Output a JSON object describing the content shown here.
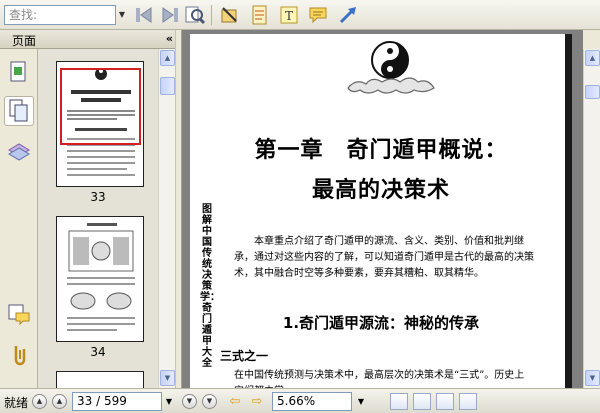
{
  "toolbar": {
    "search_placeholder": "查找:",
    "icons": [
      "prev-find-icon",
      "next-find-icon",
      "find-zoom-icon",
      "select-text-icon",
      "notes-icon",
      "text-box-icon",
      "comment-icon",
      "arrow-icon"
    ]
  },
  "panel": {
    "title": "页面",
    "collapse_label": "«",
    "tabs": [
      "pages-tab",
      "thumbnails-tab",
      "layers-tab",
      "comments-tab",
      "attachments-tab"
    ]
  },
  "thumbnails": [
    {
      "page_label": "33",
      "selected": true
    },
    {
      "page_label": "34",
      "selected": false
    }
  ],
  "document": {
    "chapter_title_line1": "第一章　奇门遁甲概说：",
    "chapter_title_line2": "最高的决策术",
    "side_label": "图解中国传统决策学：奇门遁甲大全",
    "paragraph": "本章重点介绍了奇门遁甲的源流、含义、类别、价值和批判继承，通过对这些内容的了解，可以知道奇门遁甲是古代的最高的决策术，其中融合时空等多种要素，要弃其糟粕、取其精华。",
    "section_title": "1.奇门遁甲源流：神秘的传承",
    "subsection_title": "三式之一",
    "paragraph2": "在中国传统预测与决策术中，最高层次的决策术是“三式”。历史上它们都由掌"
  },
  "statusbar": {
    "status": "就绪",
    "page_display": "33 / 599",
    "zoom": "5.66%"
  },
  "colors": {
    "selection": "#d21f1f",
    "background": "#ece9d8",
    "doc_background": "#808080"
  }
}
